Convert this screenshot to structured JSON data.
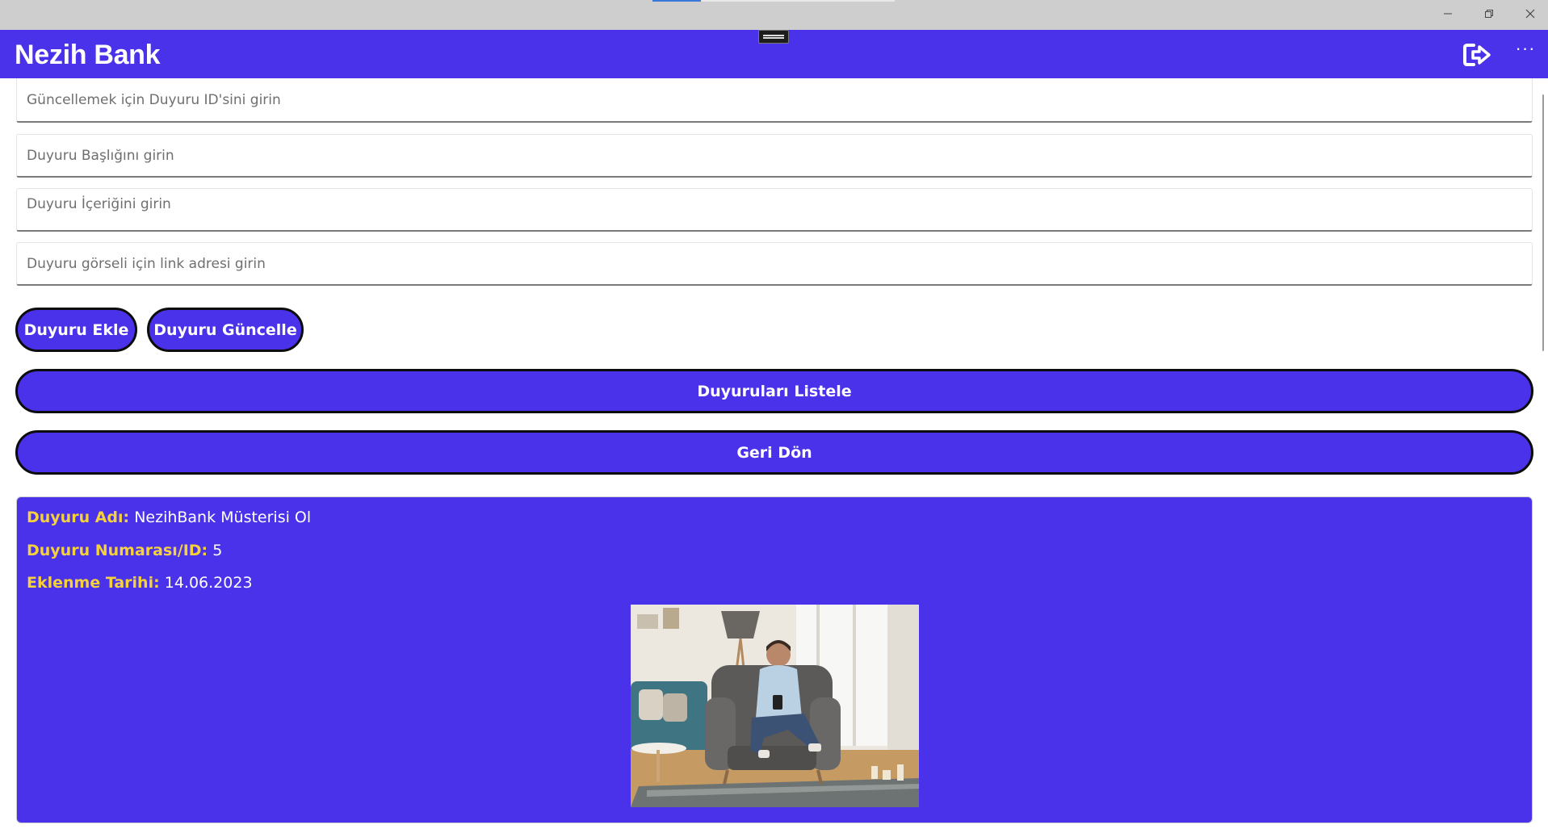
{
  "app": {
    "title": "Nezih Bank",
    "accent_color": "#4a31ea",
    "label_color": "#f5d13c"
  },
  "window_controls": {
    "minimize_icon": "minimize-icon",
    "maximize_icon": "restore-icon",
    "close_icon": "close-icon"
  },
  "header": {
    "logout_icon": "logout-icon",
    "more_icon": "more-icon",
    "more_glyph": "···"
  },
  "form": {
    "id_placeholder": "Güncellemek için Duyuru ID'sini girin",
    "title_placeholder": "Duyuru Başlığını girin",
    "content_placeholder": "Duyuru İçeriğini girin",
    "image_placeholder": "Duyuru görseli için link adresi girin"
  },
  "buttons": {
    "add": "Duyuru Ekle",
    "update": "Duyuru Güncelle",
    "list": "Duyuruları Listele",
    "back": "Geri Dön"
  },
  "announcement": {
    "name_label": "Duyuru Adı:",
    "name_value": "NezihBank Müsterisi Ol",
    "id_label": "Duyuru Numarası/ID:",
    "id_value": "5",
    "date_label": "Eklenme Tarihi:",
    "date_value": "14.06.2023"
  }
}
